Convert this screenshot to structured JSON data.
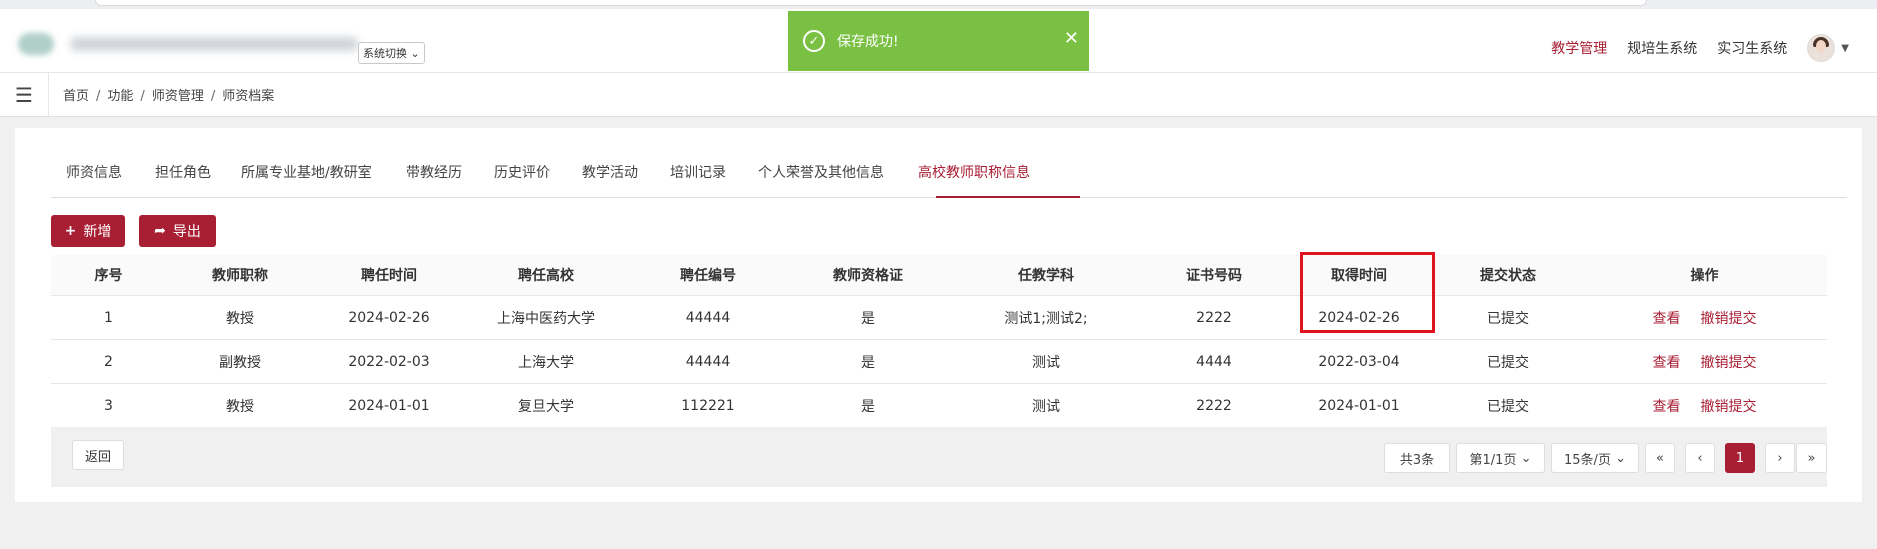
{
  "header": {
    "system_switch": "系统切换",
    "nav": [
      "教学管理",
      "规培生系统",
      "实习生系统"
    ]
  },
  "toast": {
    "message": "保存成功!"
  },
  "breadcrumb": [
    "首页",
    "功能",
    "师资管理",
    "师资档案"
  ],
  "tabs": [
    "师资信息",
    "担任角色",
    "所属专业基地/教研室",
    "带教经历",
    "历史评价",
    "教学活动",
    "培训记录",
    "个人荣誉及其他信息",
    "高校教师职称信息"
  ],
  "toolbar": {
    "add_label": "新增",
    "export_label": "导出"
  },
  "table": {
    "columns": [
      "序号",
      "教师职称",
      "聘任时间",
      "聘任高校",
      "聘任编号",
      "教师资格证",
      "任教学科",
      "证书号码",
      "取得时间",
      "提交状态",
      "操作"
    ],
    "rows": [
      [
        "1",
        "教授",
        "2024-02-26",
        "上海中医药大学",
        "44444",
        "是",
        "测试1;测试2;",
        "2222",
        "2024-02-26",
        "已提交"
      ],
      [
        "2",
        "副教授",
        "2022-02-03",
        "上海大学",
        "44444",
        "是",
        "测试",
        "4444",
        "2022-03-04",
        "已提交"
      ],
      [
        "3",
        "教授",
        "2024-01-01",
        "复旦大学",
        "112221",
        "是",
        "测试",
        "2222",
        "2024-01-01",
        "已提交"
      ]
    ],
    "actions": {
      "view": "查看",
      "revoke": "撤销提交"
    }
  },
  "footer": {
    "back_label": "返回",
    "total": "共3条",
    "page_info": "第1/1页",
    "page_size": "15条/页",
    "first": "«",
    "prev": "‹",
    "current_page": "1",
    "next": "›",
    "last": "»"
  },
  "colors": {
    "brand": "#a81e33",
    "toast": "#7ac143",
    "highlight": "#e0141e"
  }
}
